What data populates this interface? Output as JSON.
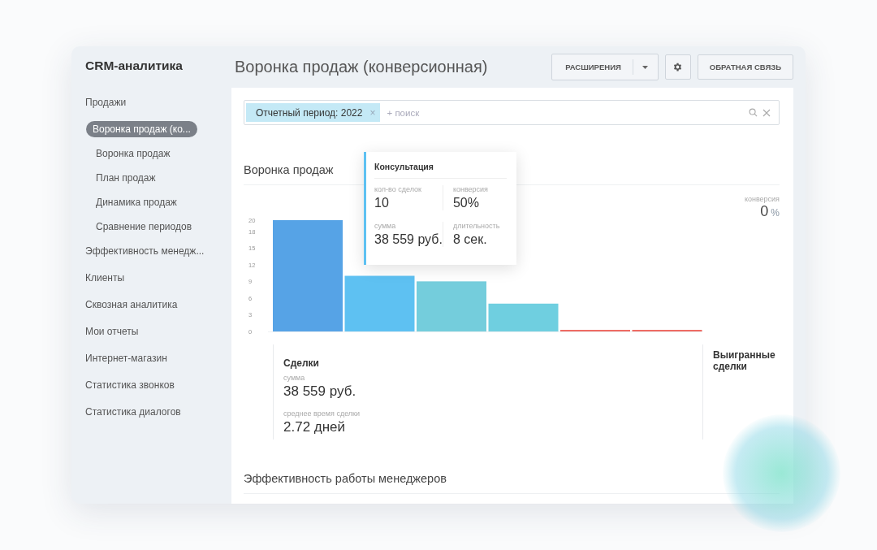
{
  "sidebar": {
    "title": "CRM-аналитика",
    "items": [
      {
        "label": "Продажи",
        "selected": false,
        "children": [
          {
            "label": "Воронка продаж (ко...",
            "selected": true
          },
          {
            "label": "Воронка продаж",
            "selected": false
          },
          {
            "label": "План продаж",
            "selected": false
          },
          {
            "label": "Динамика продаж",
            "selected": false
          },
          {
            "label": "Сравнение периодов",
            "selected": false
          }
        ]
      },
      {
        "label": "Эффективность менедж...",
        "selected": false
      },
      {
        "label": "Клиенты",
        "selected": false
      },
      {
        "label": "Сквозная аналитика",
        "selected": false
      },
      {
        "label": "Мои отчеты",
        "selected": false
      },
      {
        "label": "Интернет-магазин",
        "selected": false
      },
      {
        "label": "Статистика звонков",
        "selected": false
      },
      {
        "label": "Статистика диалогов",
        "selected": false
      }
    ]
  },
  "header": {
    "title": "Воронка продаж (конверсионная)",
    "extensions_button": "РАСШИРЕНИЯ",
    "feedback_button": "ОБРАТНАЯ СВЯЗЬ"
  },
  "filter": {
    "tag": "Отчетный период: 2022",
    "tag_remove": "×",
    "placeholder": "+ поиск"
  },
  "funnel": {
    "title": "Воронка продаж",
    "conversion": {
      "label": "конверсия",
      "value": "0",
      "unit": "%"
    },
    "chart_data": {
      "type": "bar",
      "ylim": [
        0,
        20
      ],
      "yticks": [
        0,
        3,
        6,
        9,
        12,
        15,
        18,
        20
      ],
      "series": [
        {
          "colors": [
            "#56a3e6",
            "#5ec1f2",
            "#74cddc",
            "#6fcfe0",
            "#ee6b63",
            "#ee6b63"
          ],
          "values": [
            20,
            10,
            9,
            5,
            0,
            0
          ]
        }
      ]
    },
    "tooltip": {
      "title": "Консультация",
      "stats": [
        {
          "label": "кол-во сделок",
          "value": "10"
        },
        {
          "label": "конверсия",
          "value": "50%"
        },
        {
          "label": "сумма",
          "value": "38 559 руб."
        },
        {
          "label": "длительность",
          "value": "8 сек."
        }
      ]
    },
    "summary": {
      "title": "Сделки",
      "stats": [
        {
          "label": "сумма",
          "value": "38 559 руб."
        },
        {
          "label": "среднее время сделки",
          "value": "2.72 дней"
        }
      ]
    },
    "won": {
      "title": "Выигранные сделки"
    }
  },
  "managers": {
    "title": "Эффективность работы менеджеров"
  }
}
